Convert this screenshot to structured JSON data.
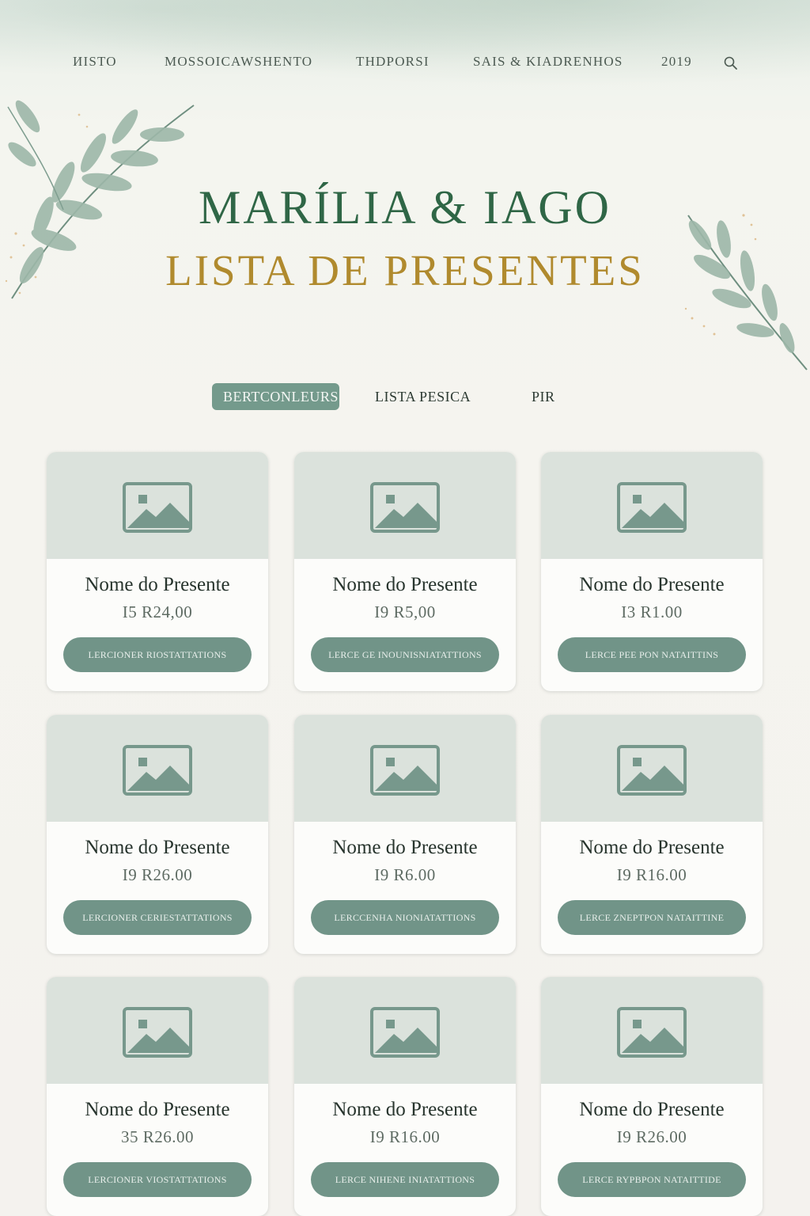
{
  "nav": {
    "items": [
      {
        "label": "ИISTO"
      },
      {
        "label": "MOSSOICAWSHENTO"
      },
      {
        "label": "THDPORSI"
      },
      {
        "label": "SAIS & KIADRENHOS"
      },
      {
        "label": "2019"
      }
    ],
    "search_icon": "search-icon"
  },
  "hero": {
    "title": "MARÍLIA & IAGO",
    "subtitle": "LISTA DE PRESENTES"
  },
  "tabs": [
    {
      "label": "BERTCONLEURS",
      "active": true
    },
    {
      "label": "LISTA PESICA",
      "active": false
    },
    {
      "label": "PIR",
      "active": false
    }
  ],
  "gifts": [
    {
      "name": "Nome do Presente",
      "price": "I5 R24,00",
      "button": "LERCIONER RIOSTATTATIONS"
    },
    {
      "name": "Nome do Presente",
      "price": "I9 R5,00",
      "button": "LERCE GE INOUNISNIATATTIONS"
    },
    {
      "name": "Nome do Presente",
      "price": "I3 R1.00",
      "button": "LERCE PEE PON NATAITTINS"
    },
    {
      "name": "Nome do Presente",
      "price": "I9 R26.00",
      "button": "LERCIONER CERIESTATTATIONS"
    },
    {
      "name": "Nome do Presente",
      "price": "I9 R6.00",
      "button": "LERCCENHA NIONIATATTIONS"
    },
    {
      "name": "Nome do Presente",
      "price": "I9 R16.00",
      "button": "LERCE ZNEPTPON NATAITTINE"
    },
    {
      "name": "Nome do Presente",
      "price": "35 R26.00",
      "button": "LERCIONER VIOSTATTATIONS"
    },
    {
      "name": "Nome do Presente",
      "price": "I9 R16.00",
      "button": "LERCE NIHENE INIATATTIONS"
    },
    {
      "name": "Nome do Presente",
      "price": "I9 R26.00",
      "button": "LERCE RYPBPON NATAITTIDE"
    }
  ],
  "colors": {
    "accent_green": "#749a8c",
    "title_green": "#2f6646",
    "title_gold": "#b08a2e",
    "card_image_bg": "#dbe2dc"
  },
  "icons": {
    "card_image": "image-placeholder-icon",
    "leaves": "eucalyptus-leaves-decoration"
  }
}
